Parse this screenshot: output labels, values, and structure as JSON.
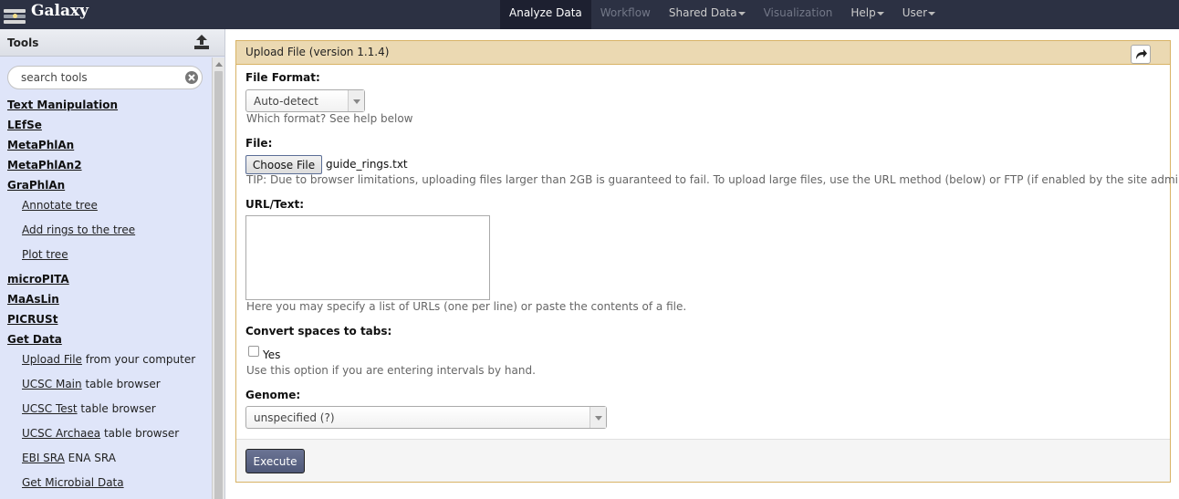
{
  "masthead": {
    "brand": "Galaxy",
    "nav": [
      {
        "label": "Analyze Data",
        "state": "active",
        "dropdown": false
      },
      {
        "label": "Workflow",
        "state": "disabled",
        "dropdown": false
      },
      {
        "label": "Shared Data",
        "state": "normal",
        "dropdown": true
      },
      {
        "label": "Visualization",
        "state": "disabled",
        "dropdown": false
      },
      {
        "label": "Help",
        "state": "normal",
        "dropdown": true
      },
      {
        "label": "User",
        "state": "normal",
        "dropdown": true
      }
    ]
  },
  "tool_panel": {
    "title": "Tools",
    "search_placeholder": "search tools",
    "sections": [
      {
        "label": "Text Manipulation"
      },
      {
        "label": "LEfSe"
      },
      {
        "label": "MetaPhlAn"
      },
      {
        "label": "MetaPhlAn2"
      },
      {
        "label": "GraPhlAn"
      },
      {
        "label": "microPITA"
      },
      {
        "label": "MaAsLin"
      },
      {
        "label": "PICRUSt"
      },
      {
        "label": "Get Data"
      }
    ],
    "graphlan_tools": [
      {
        "link": "Annotate tree",
        "text": ""
      },
      {
        "link": "Add rings to the tree",
        "text": ""
      },
      {
        "link": "Plot tree",
        "text": ""
      }
    ],
    "get_data_tools": [
      {
        "link": "Upload File",
        "text": " from your computer"
      },
      {
        "link": "UCSC Main",
        "text": " table browser"
      },
      {
        "link": "UCSC Test",
        "text": " table browser"
      },
      {
        "link": "UCSC Archaea",
        "text": " table browser"
      },
      {
        "link": "EBI SRA",
        "text": " ENA SRA"
      },
      {
        "link": "Get Microbial Data",
        "text": ""
      }
    ]
  },
  "form": {
    "title": "Upload File (version 1.1.4)",
    "file_format": {
      "label": "File Format:",
      "value": "Auto-detect",
      "help": "Which format? See help below"
    },
    "file": {
      "label": "File:",
      "button": "Choose File",
      "filename": "guide_rings.txt",
      "help": "TIP: Due to browser limitations, uploading files larger than 2GB is guaranteed to fail. To upload large files, use the URL method (below) or FTP (if enabled by the site administrator)."
    },
    "url_text": {
      "label": "URL/Text:",
      "value": "",
      "help": "Here you may specify a list of URLs (one per line) or paste the contents of a file."
    },
    "convert_spaces": {
      "label": "Convert spaces to tabs:",
      "option": "Yes",
      "checked": false,
      "help": "Use this option if you are entering intervals by hand."
    },
    "genome": {
      "label": "Genome:",
      "value": "unspecified (?)"
    },
    "execute": "Execute"
  },
  "colors": {
    "masthead_bg": "#2c3143",
    "tool_panel_bg": "#dfe5f9",
    "form_title_bg": "#ebd9b2",
    "form_border": "#d8b365",
    "execute_bg": "#5b6484"
  }
}
